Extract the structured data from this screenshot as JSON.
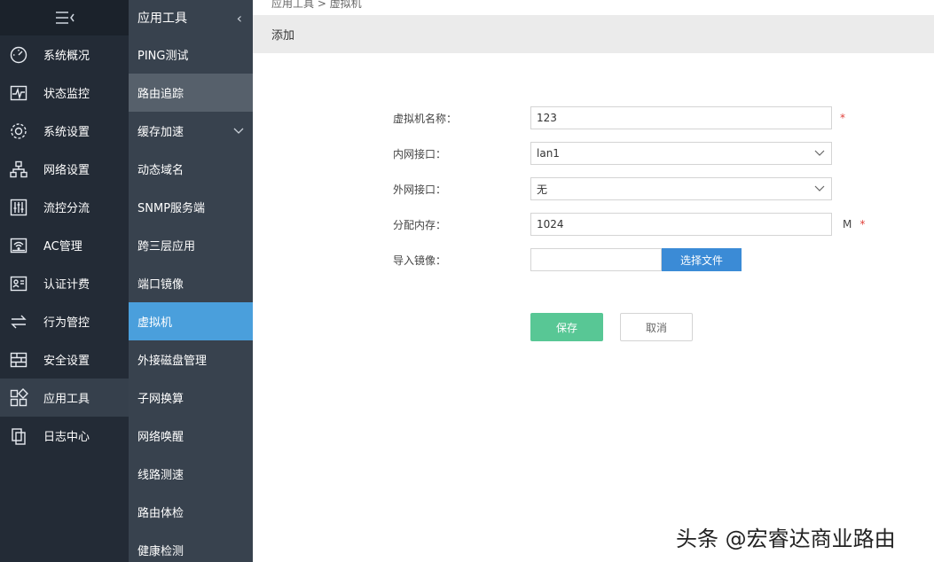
{
  "rail": {
    "items": [
      {
        "label": "系统概况",
        "icon": "gauge-icon"
      },
      {
        "label": "状态监控",
        "icon": "pulse-icon"
      },
      {
        "label": "系统设置",
        "icon": "gear-icon"
      },
      {
        "label": "网络设置",
        "icon": "network-icon"
      },
      {
        "label": "流控分流",
        "icon": "sliders-icon"
      },
      {
        "label": "AC管理",
        "icon": "wifi-icon"
      },
      {
        "label": "认证计费",
        "icon": "id-card-icon"
      },
      {
        "label": "行为管控",
        "icon": "arrows-icon"
      },
      {
        "label": "安全设置",
        "icon": "firewall-icon"
      },
      {
        "label": "应用工具",
        "icon": "apps-icon"
      },
      {
        "label": "日志中心",
        "icon": "document-icon"
      }
    ],
    "active_index": 9
  },
  "submenu": {
    "title": "应用工具",
    "items": [
      {
        "label": "PING测试"
      },
      {
        "label": "路由追踪"
      },
      {
        "label": "缓存加速"
      },
      {
        "label": "动态域名"
      },
      {
        "label": "SNMP服务端"
      },
      {
        "label": "跨三层应用"
      },
      {
        "label": "端口镜像"
      },
      {
        "label": "虚拟机"
      },
      {
        "label": "外接磁盘管理"
      },
      {
        "label": "子网换算"
      },
      {
        "label": "网络唤醒"
      },
      {
        "label": "线路测速"
      },
      {
        "label": "路由体检"
      },
      {
        "label": "健康检测"
      }
    ]
  },
  "breadcrumb": "应用工具 > 虚拟机",
  "section_title": "添加",
  "form": {
    "name_label": "虚拟机名称：",
    "name_value": "123",
    "lan_label": "内网接口：",
    "lan_value": "lan1",
    "wan_label": "外网接口：",
    "wan_value": "无",
    "memory_label": "分配内存：",
    "memory_value": "1024",
    "memory_unit": "M",
    "image_label": "导入镜像：",
    "choose_file": "选择文件",
    "required_mark": "*"
  },
  "buttons": {
    "save": "保存",
    "cancel": "取消"
  },
  "watermark": "头条 @宏睿达商业路由",
  "colors": {
    "rail_bg": "#232b36",
    "submenu_bg": "#38424e",
    "active_blue": "#4a9fdc",
    "save_green": "#58c795",
    "file_button_blue": "#3b8bd6",
    "required_red": "#e0403a"
  }
}
